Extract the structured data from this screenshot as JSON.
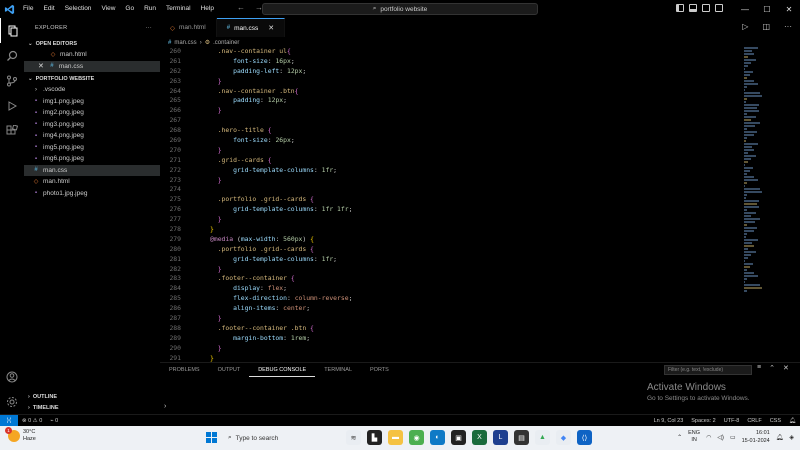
{
  "titlebar": {
    "menu": [
      "File",
      "Edit",
      "Selection",
      "View",
      "Go",
      "Run",
      "Terminal",
      "Help"
    ],
    "search": "portfolio website"
  },
  "sidebar": {
    "title": "EXPLORER",
    "open_editors": {
      "label": "OPEN EDITORS",
      "items": [
        {
          "name": "man.html",
          "type": "html"
        },
        {
          "name": "man.css",
          "type": "css"
        }
      ]
    },
    "project": {
      "label": "PORTFOLIO WEBSITE",
      "items": [
        {
          "name": ".vscode",
          "type": "folder"
        },
        {
          "name": "img1.png.jpeg",
          "type": "img"
        },
        {
          "name": "img2.png.jpeg",
          "type": "img"
        },
        {
          "name": "img3.png.jpeg",
          "type": "img"
        },
        {
          "name": "img4.png.jpeg",
          "type": "img"
        },
        {
          "name": "img5.png.jpeg",
          "type": "img"
        },
        {
          "name": "img6.png.jpeg",
          "type": "img"
        },
        {
          "name": "man.css",
          "type": "css"
        },
        {
          "name": "man.html",
          "type": "html"
        },
        {
          "name": "photo1.jpg.jpeg",
          "type": "img"
        }
      ]
    },
    "outline_label": "OUTLINE",
    "timeline_label": "TIMELINE"
  },
  "tabs": [
    {
      "name": "man.html",
      "active": false
    },
    {
      "name": "man.css",
      "active": true
    }
  ],
  "breadcrumb": [
    "man.css",
    ".container"
  ],
  "code": [
    {
      "n": "260",
      "t": "  .nav--container ul{"
    },
    {
      "n": "261",
      "t": "      font-size: 16px;"
    },
    {
      "n": "262",
      "t": "      padding-left: 12px;"
    },
    {
      "n": "263",
      "t": "  }"
    },
    {
      "n": "264",
      "t": "  .nav--container .btn{"
    },
    {
      "n": "265",
      "t": "      padding: 12px;"
    },
    {
      "n": "266",
      "t": "  }"
    },
    {
      "n": "267",
      "t": ""
    },
    {
      "n": "268",
      "t": "  .hero--title {"
    },
    {
      "n": "269",
      "t": "      font-size: 26px;"
    },
    {
      "n": "270",
      "t": "  }"
    },
    {
      "n": "271",
      "t": "  .grid--cards {"
    },
    {
      "n": "272",
      "t": "      grid-template-columns: 1fr;"
    },
    {
      "n": "273",
      "t": "  }"
    },
    {
      "n": "274",
      "t": ""
    },
    {
      "n": "275",
      "t": "  .portfolio .grid--cards {"
    },
    {
      "n": "276",
      "t": "      grid-template-columns: 1fr 1fr;"
    },
    {
      "n": "277",
      "t": "  }"
    },
    {
      "n": "278",
      "t": "}"
    },
    {
      "n": "279",
      "t": "@media (max-width: 560px) {"
    },
    {
      "n": "280",
      "t": "  .portfolio .grid--cards {"
    },
    {
      "n": "281",
      "t": "      grid-template-columns: 1fr;"
    },
    {
      "n": "282",
      "t": "  }"
    },
    {
      "n": "283",
      "t": "  .footer--container {"
    },
    {
      "n": "284",
      "t": "      display: flex;"
    },
    {
      "n": "285",
      "t": "      flex-direction: column-reverse;"
    },
    {
      "n": "286",
      "t": "      align-items: center;"
    },
    {
      "n": "287",
      "t": "  }"
    },
    {
      "n": "288",
      "t": "  .footer--container .btn {"
    },
    {
      "n": "289",
      "t": "      margin-bottom: 1rem;"
    },
    {
      "n": "290",
      "t": "  }"
    },
    {
      "n": "291",
      "t": "}"
    }
  ],
  "panel": {
    "tabs": [
      "PROBLEMS",
      "OUTPUT",
      "DEBUG CONSOLE",
      "TERMINAL",
      "PORTS"
    ],
    "active_tab": "DEBUG CONSOLE",
    "filter_placeholder": "Filter (e.g. text, !exclude)"
  },
  "activation": {
    "title": "Activate Windows",
    "subtitle": "Go to Settings to activate Windows."
  },
  "statusbar": {
    "errors": "0",
    "warnings": "0",
    "ports": "0",
    "position": "Ln 9, Col 23",
    "spaces": "Spaces: 2",
    "encoding": "UTF-8",
    "eol": "CRLF",
    "language": "CSS"
  },
  "taskbar": {
    "weather_temp": "30°C",
    "weather_desc": "Haze",
    "weather_badge": "1",
    "search_placeholder": "Type to search",
    "lang_top": "ENG",
    "lang_bottom": "IN",
    "time": "16:01",
    "date": "15-01-2024"
  },
  "colors": {
    "accent": "#0078d4",
    "selector": "#d7ba7d",
    "property": "#9cdcfe",
    "value": "#ce9178",
    "number": "#b5cea8",
    "at_rule": "#c586c0"
  }
}
